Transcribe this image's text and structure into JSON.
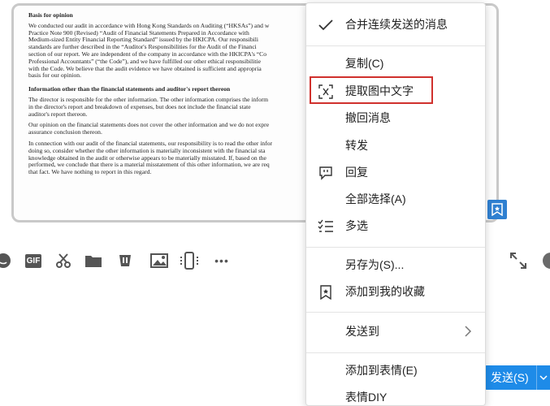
{
  "document": {
    "heading1": "Basis for opinion",
    "para1": [
      "We conducted our audit in accordance with Hong Kong Standards on Auditing (“HKSAs”) and w",
      "Practice Note 900 (Revised) “Audit of Financial Statements Prepared in Accordance with",
      "Medium-sized Entity Financial Reporting Standard” issued by the HKICPA. Our responsibili",
      "standards are further described in the “Auditor's Responsibilities for the Audit of the Financi",
      "section of our report. We are independent of the company in accordance with the HKICPA's “Co",
      "Professional Accountants” (“the Code”), and we have fulfilled our other ethical responsibilitie",
      "with the Code. We believe that the audit evidence we have obtained is sufficient and appropria",
      "basis for our opinion."
    ],
    "heading2": "Information other than the financial statements and auditor's report thereon",
    "para2": [
      "The director is responsible for the other information. The other information comprises the inform",
      "in the director's report and breakdown of expenses, but does not include the financial state",
      "auditor's report thereon."
    ],
    "para3": [
      "Our opinion on the financial statements does not cover the other information and we do not expre",
      "assurance conclusion thereon."
    ],
    "para4": [
      "In connection with our audit of the financial statements, our responsibility is to read the other infor",
      "doing so, consider whether the other information is materially inconsistent with the financial sta",
      "knowledge obtained in the audit or otherwise appears to be materially misstated. If, based on the",
      "performed, we conclude that there is a material misstatement of this other information, we are req",
      "that fact. We have nothing to report in this regard."
    ]
  },
  "menu": {
    "merge_forward": "合并连续发送的消息",
    "copy": "复制(C)",
    "extract_text": "提取图中文字",
    "recall": "撤回消息",
    "forward": "转发",
    "reply": "回复",
    "select_all": "全部选择(A)",
    "multi_select": "多选",
    "save_as": "另存为(S)...",
    "add_favorite": "添加到我的收藏",
    "send_to": "发送到",
    "add_sticker": "添加到表情(E)",
    "sticker_diy": "表情DIY"
  },
  "toolbar": {
    "gif_label": "GIF",
    "more_label": "•••"
  },
  "send": {
    "label": "发送(S)"
  },
  "colors": {
    "accent_blue": "#1e8be8",
    "highlight_red": "#d0312d"
  }
}
